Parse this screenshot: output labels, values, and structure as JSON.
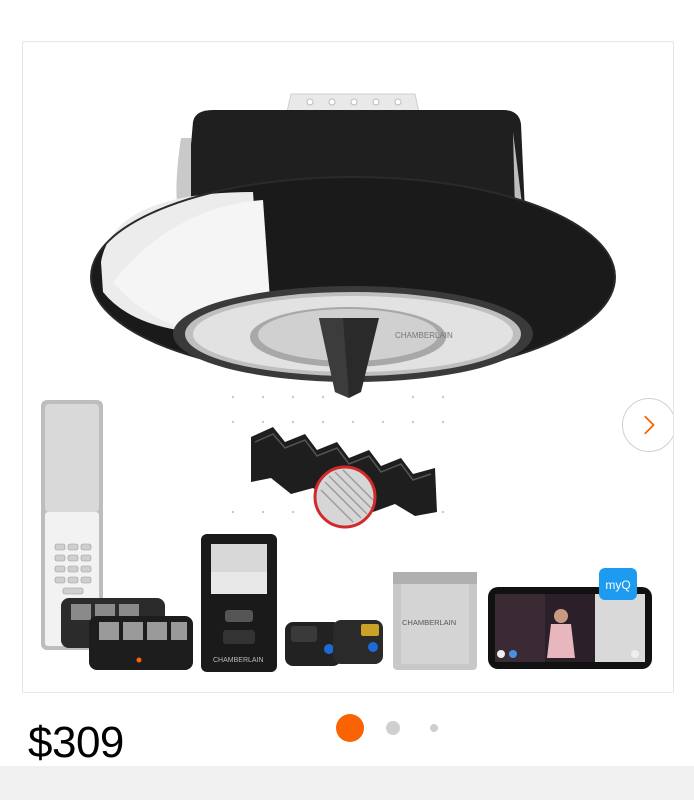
{
  "product": {
    "price": "$309",
    "brand_mark": "CHAMBERLAIN",
    "app_badge": "myQ"
  },
  "carousel": {
    "total_slides": 3,
    "active_index": 0
  },
  "colors": {
    "accent": "#f96302",
    "dot_inactive": "#cfcfcf",
    "app_badge": "#1d9bf0"
  },
  "icons": {
    "next": "chevron-right-icon"
  }
}
